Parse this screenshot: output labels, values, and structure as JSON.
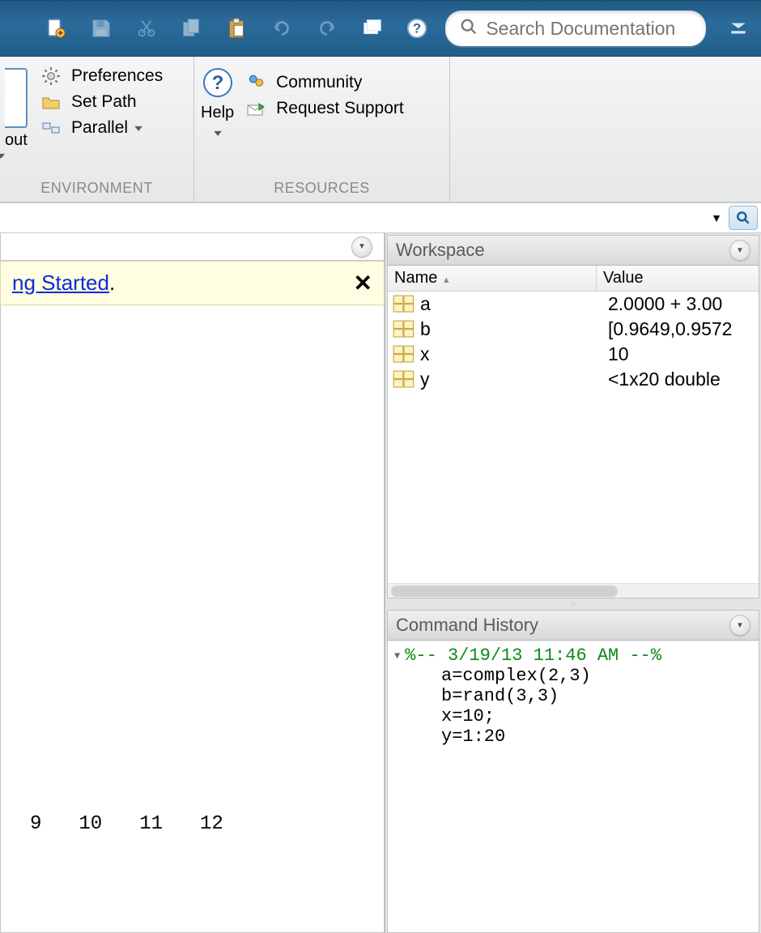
{
  "toolbar": {
    "search_placeholder": "Search Documentation"
  },
  "ribbon": {
    "environment": {
      "partial_button": "out",
      "preferences": "Preferences",
      "set_path": "Set Path",
      "parallel": "Parallel",
      "title": "ENVIRONMENT"
    },
    "resources": {
      "help": "Help",
      "community": "Community",
      "request_support": "Request Support",
      "title": "RESOURCES"
    }
  },
  "getting_started": {
    "link_text": "ng Started",
    "period": "."
  },
  "command_window_numbers": [
    "9",
    "10",
    "11",
    "12"
  ],
  "workspace": {
    "title": "Workspace",
    "col_name": "Name",
    "col_value": "Value",
    "vars": [
      {
        "name": "a",
        "value": "2.0000 + 3.00"
      },
      {
        "name": "b",
        "value": "[0.9649,0.9572"
      },
      {
        "name": "x",
        "value": "10"
      },
      {
        "name": "y",
        "value": "<1x20 double"
      }
    ]
  },
  "command_history": {
    "title": "Command History",
    "date": "%-- 3/19/13 11:46 AM --%",
    "lines": [
      "a=complex(2,3)",
      "b=rand(3,3)",
      "x=10;",
      "y=1:20"
    ]
  }
}
